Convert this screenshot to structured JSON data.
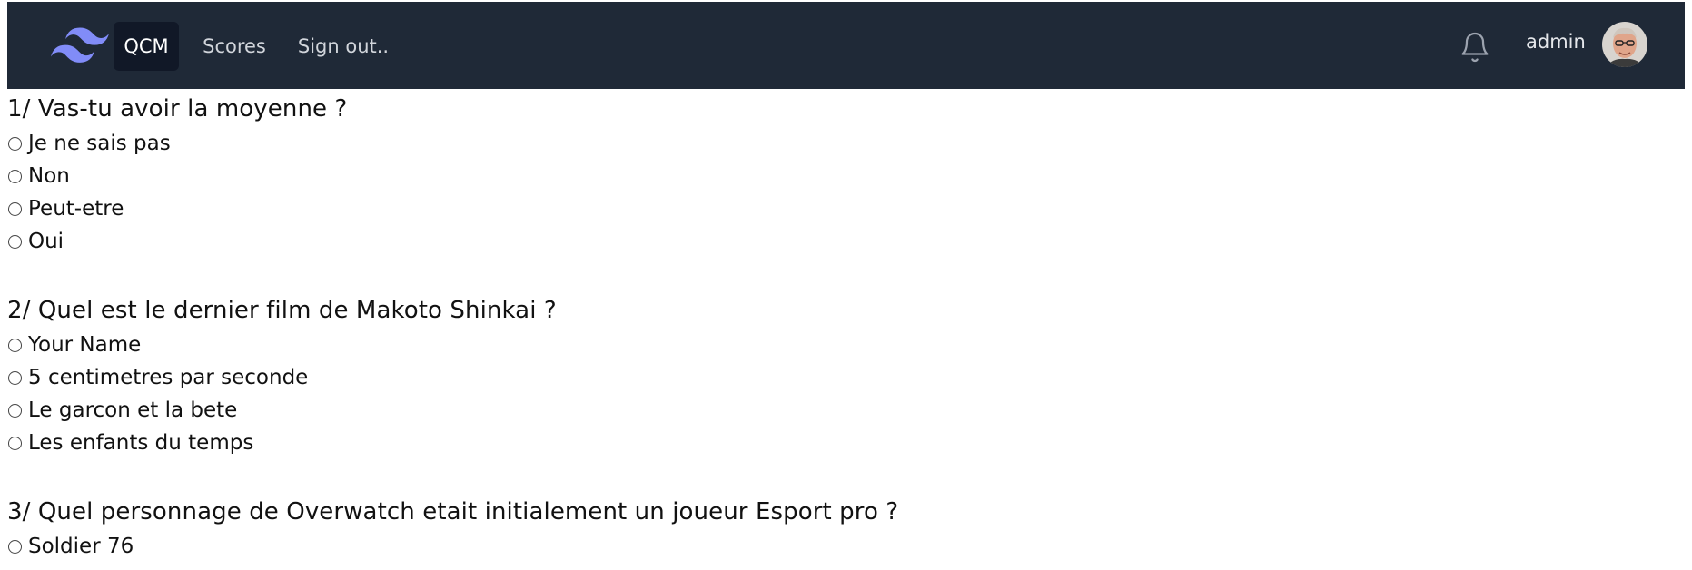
{
  "nav": {
    "logo_icon": "tailwind-logo-icon",
    "links": [
      {
        "label": "QCM",
        "active": true
      },
      {
        "label": "Scores",
        "active": false
      },
      {
        "label": "Sign out..",
        "active": false
      }
    ],
    "bell_icon": "bell-icon",
    "username": "admin",
    "avatar_icon": "avatar",
    "colors": {
      "bar": "#1f2937",
      "active_bg": "#111827",
      "logo": "#818cf8"
    }
  },
  "questions": [
    {
      "title": "1/ Vas-tu avoir la moyenne ?",
      "answers": [
        "Je ne sais pas",
        "Non",
        "Peut-etre",
        "Oui"
      ]
    },
    {
      "title": "2/ Quel est le dernier film de Makoto Shinkai ?",
      "answers": [
        "Your Name",
        "5 centimetres par seconde",
        "Le garcon et la bete",
        "Les enfants du temps"
      ]
    },
    {
      "title": "3/ Quel personnage de Overwatch etait initialement un joueur Esport pro ?",
      "answers": [
        "Soldier 76"
      ]
    }
  ]
}
